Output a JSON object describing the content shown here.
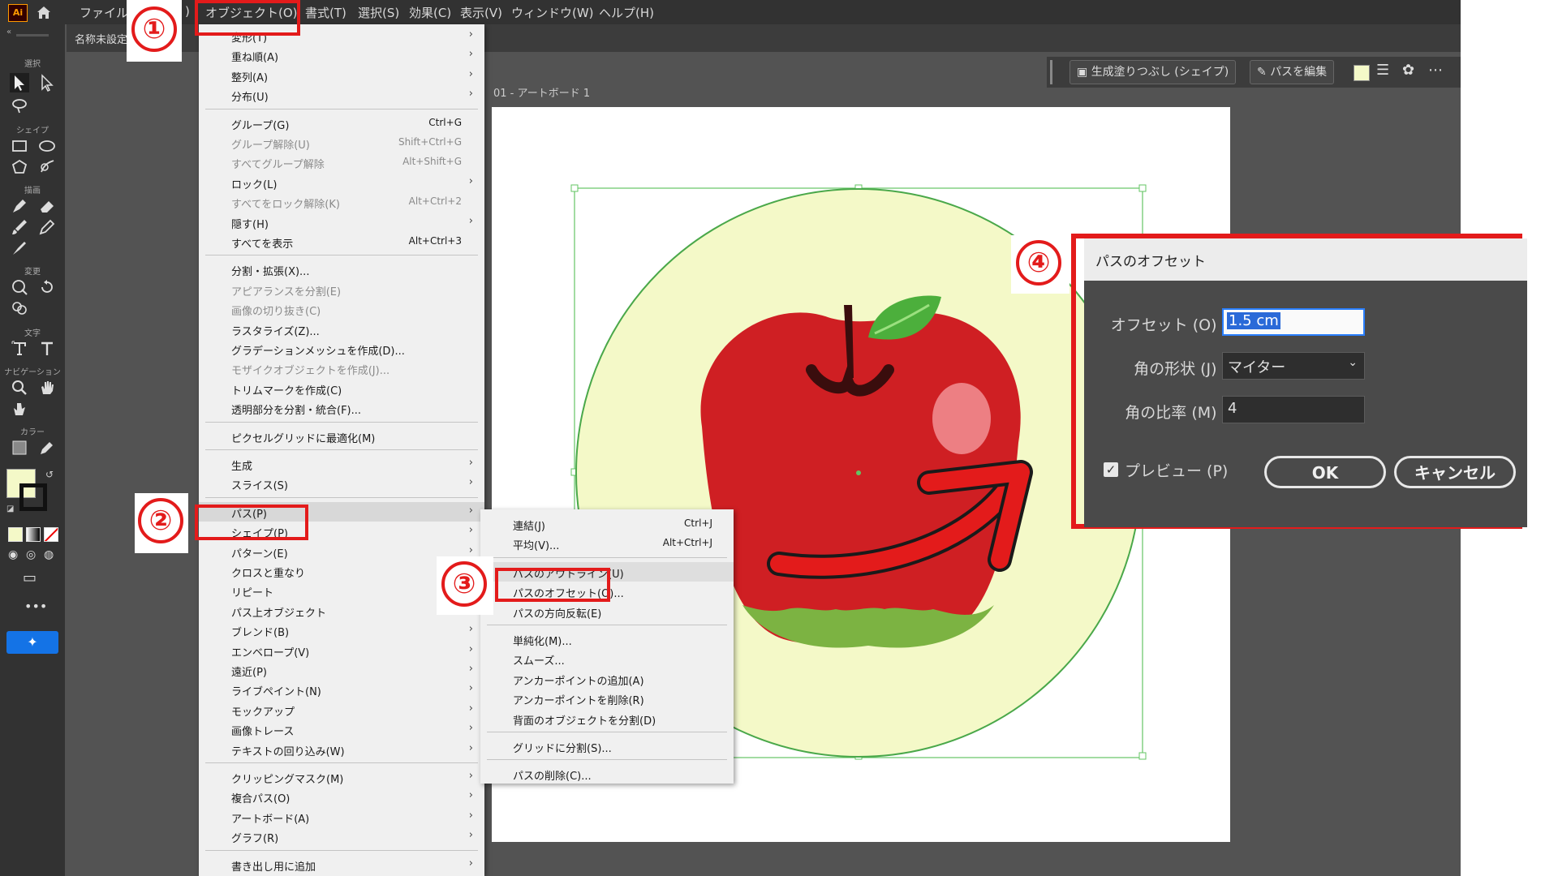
{
  "menubar": {
    "app_logo": "Ai",
    "items": [
      "ファイル",
      ")",
      "オブジェクト(O)",
      "書式(T)",
      "選択(S)",
      "効果(C)",
      "表示(V)",
      "ウィンドウ(W)",
      "ヘルプ(H)"
    ]
  },
  "document": {
    "tab_title": "名称未設定",
    "artboard_label": "01 - アートボード 1"
  },
  "toolbar": {
    "labels": [
      "選択",
      "シェイプ",
      "描画",
      "変更",
      "文字",
      "ナビゲーション",
      "カラー"
    ]
  },
  "controlbar": {
    "generative_fill": "生成塗りつぶし (シェイプ)",
    "edit_path": "パスを編集"
  },
  "object_menu": {
    "items": [
      {
        "label": "変形(T)",
        "shortcut": "",
        "submenu": true,
        "disabled": false
      },
      {
        "label": "重ね順(A)",
        "shortcut": "",
        "submenu": true,
        "disabled": false
      },
      {
        "label": "整列(A)",
        "shortcut": "",
        "submenu": true,
        "disabled": false
      },
      {
        "label": "分布(U)",
        "shortcut": "",
        "submenu": true,
        "disabled": false
      },
      {
        "label": "グループ(G)",
        "shortcut": "Ctrl+G",
        "submenu": false,
        "disabled": false
      },
      {
        "label": "グループ解除(U)",
        "shortcut": "Shift+Ctrl+G",
        "submenu": false,
        "disabled": true
      },
      {
        "label": "すべてグループ解除",
        "shortcut": "Alt+Shift+G",
        "submenu": false,
        "disabled": true
      },
      {
        "label": "ロック(L)",
        "shortcut": "",
        "submenu": true,
        "disabled": false
      },
      {
        "label": "すべてをロック解除(K)",
        "shortcut": "Alt+Ctrl+2",
        "submenu": false,
        "disabled": true
      },
      {
        "label": "隠す(H)",
        "shortcut": "",
        "submenu": true,
        "disabled": false
      },
      {
        "label": "すべてを表示",
        "shortcut": "Alt+Ctrl+3",
        "submenu": false,
        "disabled": false
      },
      {
        "label": "分割・拡張(X)...",
        "shortcut": "",
        "submenu": false,
        "disabled": false
      },
      {
        "label": "アピアランスを分割(E)",
        "shortcut": "",
        "submenu": false,
        "disabled": true
      },
      {
        "label": "画像の切り抜き(C)",
        "shortcut": "",
        "submenu": false,
        "disabled": true
      },
      {
        "label": "ラスタライズ(Z)...",
        "shortcut": "",
        "submenu": false,
        "disabled": false
      },
      {
        "label": "グラデーションメッシュを作成(D)...",
        "shortcut": "",
        "submenu": false,
        "disabled": false
      },
      {
        "label": "モザイクオブジェクトを作成(J)...",
        "shortcut": "",
        "submenu": false,
        "disabled": true
      },
      {
        "label": "トリムマークを作成(C)",
        "shortcut": "",
        "submenu": false,
        "disabled": false
      },
      {
        "label": "透明部分を分割・統合(F)...",
        "shortcut": "",
        "submenu": false,
        "disabled": false
      },
      {
        "label": "ピクセルグリッドに最適化(M)",
        "shortcut": "",
        "submenu": false,
        "disabled": false
      },
      {
        "label": "生成",
        "shortcut": "",
        "submenu": true,
        "disabled": false
      },
      {
        "label": "スライス(S)",
        "shortcut": "",
        "submenu": true,
        "disabled": false
      },
      {
        "label": "パス(P)",
        "shortcut": "",
        "submenu": true,
        "disabled": false,
        "highlighted": true
      },
      {
        "label": "シェイプ(P)",
        "shortcut": "",
        "submenu": true,
        "disabled": false
      },
      {
        "label": "パターン(E)",
        "shortcut": "",
        "submenu": true,
        "disabled": false
      },
      {
        "label": "クロスと重なり",
        "shortcut": "",
        "submenu": false,
        "disabled": false
      },
      {
        "label": "リピート",
        "shortcut": "",
        "submenu": true,
        "disabled": false
      },
      {
        "label": "パス上オブジェクト",
        "shortcut": "",
        "submenu": true,
        "disabled": false
      },
      {
        "label": "ブレンド(B)",
        "shortcut": "",
        "submenu": true,
        "disabled": false
      },
      {
        "label": "エンベロープ(V)",
        "shortcut": "",
        "submenu": true,
        "disabled": false
      },
      {
        "label": "遠近(P)",
        "shortcut": "",
        "submenu": true,
        "disabled": false
      },
      {
        "label": "ライブペイント(N)",
        "shortcut": "",
        "submenu": true,
        "disabled": false
      },
      {
        "label": "モックアップ",
        "shortcut": "",
        "submenu": true,
        "disabled": false
      },
      {
        "label": "画像トレース",
        "shortcut": "",
        "submenu": true,
        "disabled": false
      },
      {
        "label": "テキストの回り込み(W)",
        "shortcut": "",
        "submenu": true,
        "disabled": false
      },
      {
        "label": "クリッピングマスク(M)",
        "shortcut": "",
        "submenu": true,
        "disabled": false
      },
      {
        "label": "複合パス(O)",
        "shortcut": "",
        "submenu": true,
        "disabled": false
      },
      {
        "label": "アートボード(A)",
        "shortcut": "",
        "submenu": true,
        "disabled": false
      },
      {
        "label": "グラフ(R)",
        "shortcut": "",
        "submenu": true,
        "disabled": false
      },
      {
        "label": "書き出し用に追加",
        "shortcut": "",
        "submenu": true,
        "disabled": false
      }
    ]
  },
  "path_submenu": {
    "items": [
      {
        "label": "連結(J)",
        "shortcut": "Ctrl+J"
      },
      {
        "label": "平均(V)...",
        "shortcut": "Alt+Ctrl+J"
      },
      {
        "label": "パスのアウトライン(U)",
        "shortcut": ""
      },
      {
        "label": "パスのオフセット(O)...",
        "shortcut": ""
      },
      {
        "label": "パスの方向反転(E)",
        "shortcut": ""
      },
      {
        "label": "単純化(M)...",
        "shortcut": ""
      },
      {
        "label": "スムーズ...",
        "shortcut": ""
      },
      {
        "label": "アンカーポイントの追加(A)",
        "shortcut": ""
      },
      {
        "label": "アンカーポイントを削除(R)",
        "shortcut": ""
      },
      {
        "label": "背面のオブジェクトを分割(D)",
        "shortcut": ""
      },
      {
        "label": "グリッドに分割(S)...",
        "shortcut": ""
      },
      {
        "label": "パスの削除(C)...",
        "shortcut": ""
      }
    ]
  },
  "badges": {
    "one": "①",
    "two": "②",
    "three": "③",
    "four": "④"
  },
  "offset_dialog": {
    "title": "パスのオフセット",
    "offset_label": "オフセット (O) :",
    "offset_value": "1.5 cm",
    "join_label": "角の形状 (J) :",
    "join_value": "マイター",
    "miter_label": "角の比率 (M) :",
    "miter_value": "4",
    "preview_label": "プレビュー (P)",
    "preview_checked": true,
    "ok": "OK",
    "cancel": "キャンセル"
  },
  "colors": {
    "annotation_red": "#e31b1b",
    "fill_swatch": "#f4f9c8",
    "apple_red": "#cf1f23",
    "leaf_green": "#4caf3c"
  }
}
